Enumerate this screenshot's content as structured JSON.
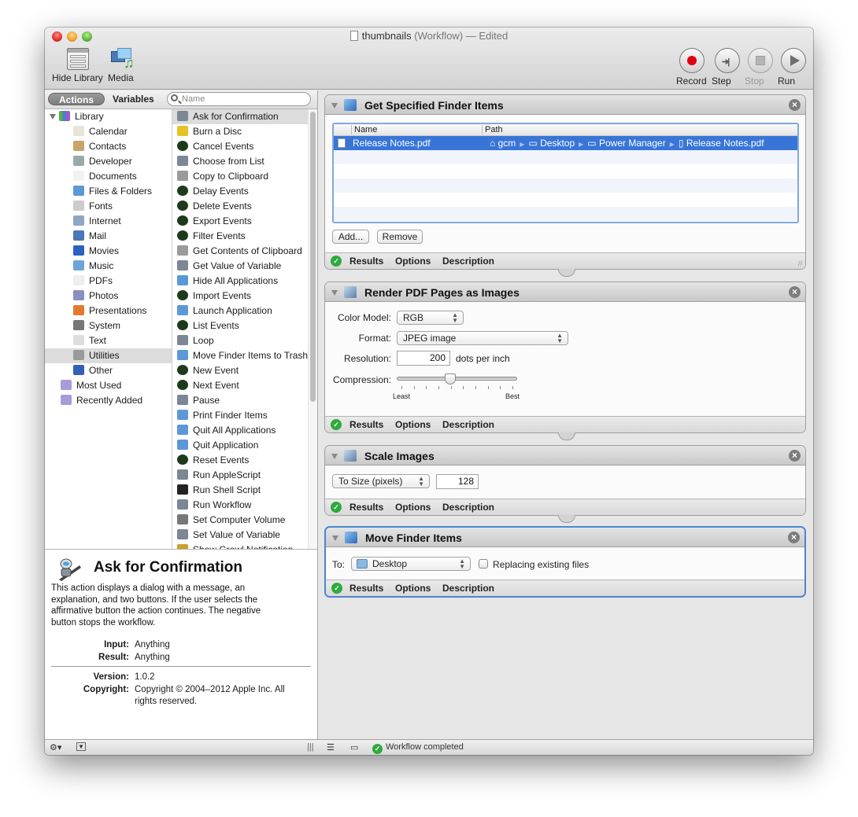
{
  "window": {
    "title": "thumbnails",
    "subtitle": "(Workflow) — Edited",
    "toolbar_left": [
      {
        "label": "Hide Library",
        "icon": "library-icon"
      },
      {
        "label": "Media",
        "icon": "media-icon"
      }
    ],
    "toolbar_right": [
      {
        "label": "Record",
        "icon": "record-icon",
        "enabled": true
      },
      {
        "label": "Step",
        "icon": "step-icon",
        "enabled": true
      },
      {
        "label": "Stop",
        "icon": "stop-icon",
        "enabled": false
      },
      {
        "label": "Run",
        "icon": "run-icon",
        "enabled": true
      }
    ]
  },
  "library": {
    "segment": {
      "actions": "Actions",
      "variables": "Variables",
      "selected": "Actions"
    },
    "search_placeholder": "Name",
    "root": "Library",
    "categories": [
      {
        "label": "Calendar",
        "icon": "calendar-icon"
      },
      {
        "label": "Contacts",
        "icon": "contacts-icon"
      },
      {
        "label": "Developer",
        "icon": "developer-icon"
      },
      {
        "label": "Documents",
        "icon": "documents-icon"
      },
      {
        "label": "Files & Folders",
        "icon": "finder-icon"
      },
      {
        "label": "Fonts",
        "icon": "fonts-icon"
      },
      {
        "label": "Internet",
        "icon": "internet-icon"
      },
      {
        "label": "Mail",
        "icon": "mail-icon"
      },
      {
        "label": "Movies",
        "icon": "movies-icon"
      },
      {
        "label": "Music",
        "icon": "music-icon"
      },
      {
        "label": "PDFs",
        "icon": "pdf-icon"
      },
      {
        "label": "Photos",
        "icon": "photos-icon"
      },
      {
        "label": "Presentations",
        "icon": "presentations-icon"
      },
      {
        "label": "System",
        "icon": "system-icon"
      },
      {
        "label": "Text",
        "icon": "text-icon"
      },
      {
        "label": "Utilities",
        "icon": "utilities-icon",
        "selected": true
      },
      {
        "label": "Other",
        "icon": "other-icon"
      }
    ],
    "smart_groups": [
      {
        "label": "Most Used",
        "icon": "smart-folder-icon"
      },
      {
        "label": "Recently Added",
        "icon": "smart-folder-icon"
      }
    ],
    "actions": [
      {
        "label": "Ask for Confirmation",
        "icon": "automator-icon",
        "selected": true
      },
      {
        "label": "Burn a Disc",
        "icon": "burn-icon"
      },
      {
        "label": "Cancel Events",
        "icon": "ical-alarm-icon"
      },
      {
        "label": "Choose from List",
        "icon": "automator-icon"
      },
      {
        "label": "Copy to Clipboard",
        "icon": "utilities-icon"
      },
      {
        "label": "Delay Events",
        "icon": "ical-alarm-icon"
      },
      {
        "label": "Delete Events",
        "icon": "ical-alarm-icon"
      },
      {
        "label": "Export Events",
        "icon": "ical-alarm-icon"
      },
      {
        "label": "Filter Events",
        "icon": "ical-alarm-icon"
      },
      {
        "label": "Get Contents of Clipboard",
        "icon": "utilities-icon"
      },
      {
        "label": "Get Value of Variable",
        "icon": "automator-icon"
      },
      {
        "label": "Hide All Applications",
        "icon": "finder-icon"
      },
      {
        "label": "Import Events",
        "icon": "ical-alarm-icon"
      },
      {
        "label": "Launch Application",
        "icon": "finder-icon"
      },
      {
        "label": "List Events",
        "icon": "ical-alarm-icon"
      },
      {
        "label": "Loop",
        "icon": "automator-icon"
      },
      {
        "label": "Move Finder Items to Trash",
        "icon": "finder-icon"
      },
      {
        "label": "New Event",
        "icon": "ical-alarm-icon"
      },
      {
        "label": "Next Event",
        "icon": "ical-alarm-icon"
      },
      {
        "label": "Pause",
        "icon": "automator-icon"
      },
      {
        "label": "Print Finder Items",
        "icon": "finder-icon"
      },
      {
        "label": "Quit All Applications",
        "icon": "finder-icon"
      },
      {
        "label": "Quit Application",
        "icon": "finder-icon"
      },
      {
        "label": "Reset Events",
        "icon": "ical-alarm-icon"
      },
      {
        "label": "Run AppleScript",
        "icon": "automator-icon"
      },
      {
        "label": "Run Shell Script",
        "icon": "terminal-icon"
      },
      {
        "label": "Run Workflow",
        "icon": "automator-icon"
      },
      {
        "label": "Set Computer Volume",
        "icon": "system-icon"
      },
      {
        "label": "Set Value of Variable",
        "icon": "automator-icon"
      },
      {
        "label": "Show Growl Notification",
        "icon": "growl-icon"
      }
    ],
    "scroll_position": 0.0,
    "scroll_visible_fraction": 0.67
  },
  "description": {
    "title": "Ask for Confirmation",
    "body": "This action displays a dialog with a message, an explanation, and two buttons. If the user selects the affirmative button the action continues. The negative button stops the workflow.",
    "input_label": "Input:",
    "input_value": "Anything",
    "result_label": "Result:",
    "result_value": "Anything",
    "version_label": "Version:",
    "version_value": "1.0.2",
    "copyright_label": "Copyright:",
    "copyright_value": "Copyright © 2004–2012 Apple Inc.  All rights reserved."
  },
  "workflow": {
    "footer_tabs": [
      "Results",
      "Options",
      "Description"
    ],
    "actions": [
      {
        "title": "Get Specified Finder Items",
        "icon": "finder-icon",
        "table": {
          "columns": [
            "Name",
            "Path"
          ],
          "rows": [
            {
              "name": "Release Notes.pdf",
              "path": [
                "gcm",
                "Desktop",
                "Power Manager",
                "Release Notes.pdf"
              ]
            }
          ]
        },
        "buttons": [
          "Add...",
          "Remove"
        ]
      },
      {
        "title": "Render PDF Pages as Images",
        "icon": "preview-icon",
        "color_model_label": "Color Model:",
        "color_model": "RGB",
        "format_label": "Format:",
        "format": "JPEG image",
        "resolution_label": "Resolution:",
        "resolution": "200",
        "resolution_unit": "dots per inch",
        "compression_label": "Compression:",
        "compression_min": "Least",
        "compression_max": "Best",
        "compression_value": 0.44
      },
      {
        "title": "Scale Images",
        "icon": "preview-icon",
        "mode": "To Size (pixels)",
        "size": "128"
      },
      {
        "title": "Move Finder Items",
        "icon": "finder-icon",
        "to_label": "To:",
        "destination": "Desktop",
        "replace_label": "Replacing existing files",
        "replace_checked": false,
        "selected": true
      }
    ]
  },
  "status": {
    "text": "Workflow completed"
  }
}
